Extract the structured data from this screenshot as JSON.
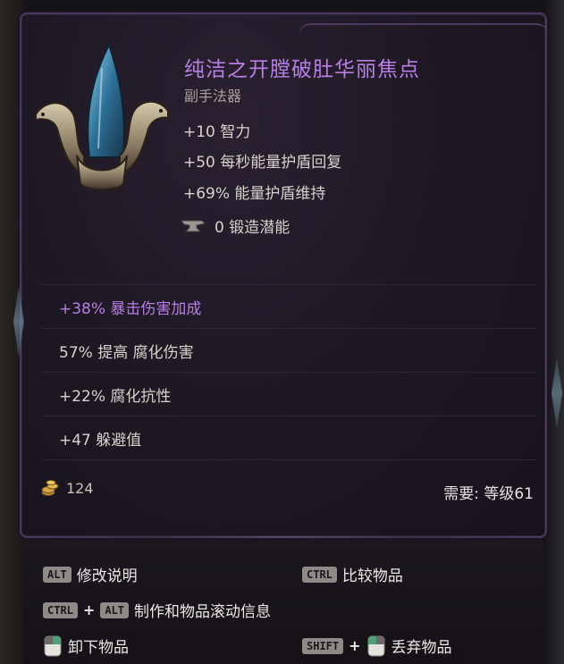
{
  "item": {
    "name": "纯洁之开膛破肚华丽焦点",
    "type": "副手法器",
    "implicits": [
      "+10 智力",
      "+50 每秒能量护盾回复",
      "+69% 能量护盾维持"
    ],
    "forge_potential": "0 锻造潜能",
    "affixes": [
      {
        "text": "+38% 暴击伤害加成",
        "special": true
      },
      {
        "text": "57% 提高 腐化伤害",
        "special": false
      },
      {
        "text": "+22% 腐化抗性",
        "special": false
      },
      {
        "text": "+47 躲避值",
        "special": false
      }
    ],
    "gold": "124",
    "requirement": "需要: 等级61"
  },
  "hints": {
    "alt_key": "ALT",
    "ctrl_key": "CTRL",
    "shift_key": "SHIFT",
    "plus": "+",
    "modify_desc": "修改说明",
    "compare": "比较物品",
    "craft_scroll": "制作和物品滚动信息",
    "unequip": "卸下物品",
    "discard": "丢弃物品"
  },
  "colors": {
    "title": "#b77fe6",
    "special_affix": "#b77fe6",
    "frame": "#4a3b60"
  },
  "icons": [
    "item-focus-icon",
    "anvil-icon",
    "gold-coins-icon",
    "mouse-right-icon",
    "mouse-left-icon"
  ]
}
